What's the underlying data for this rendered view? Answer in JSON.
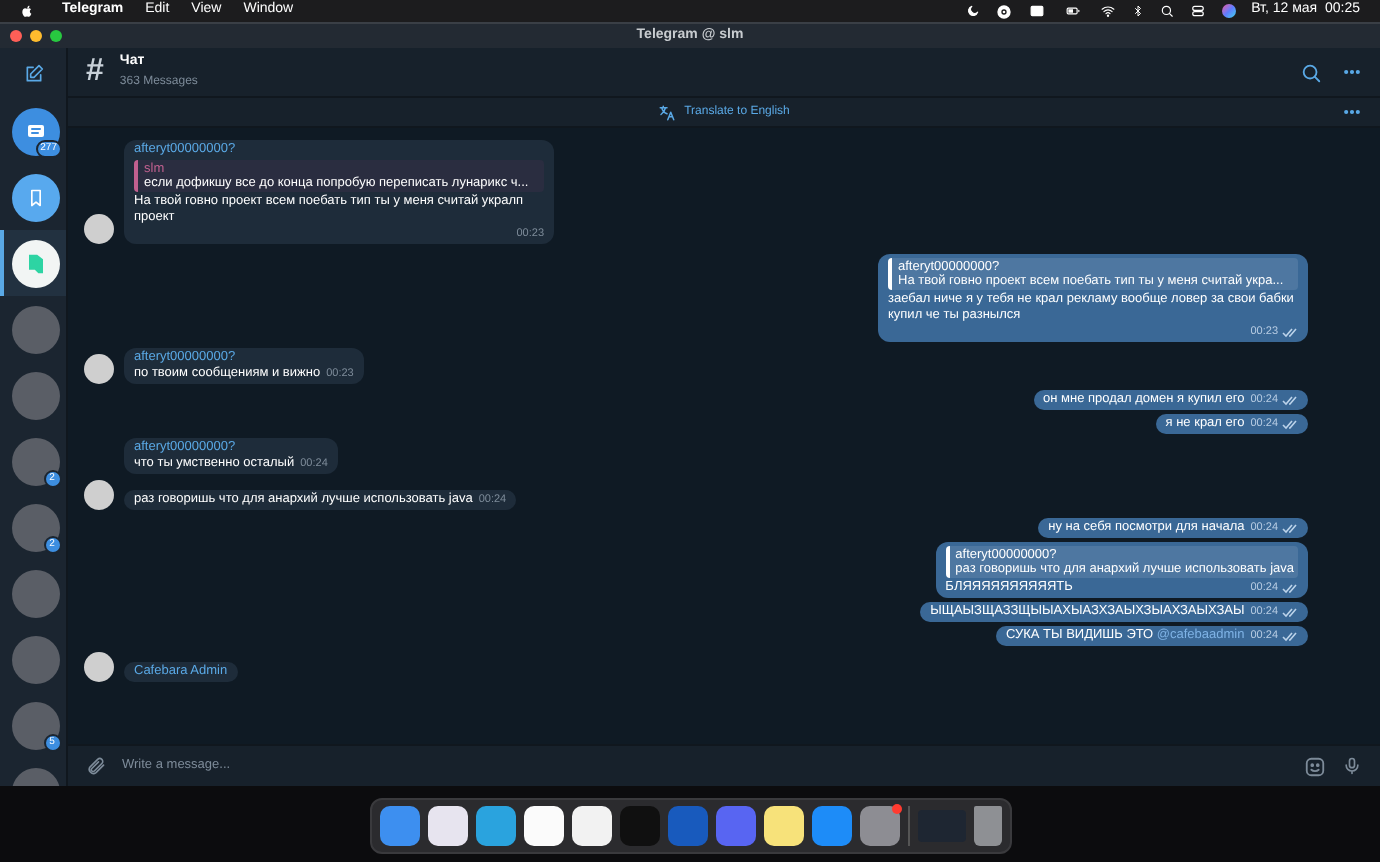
{
  "menu_bar": {
    "app": "Telegram",
    "menus": [
      "Edit",
      "View",
      "Window"
    ],
    "clock": "Вт, 12 мая  00:25"
  },
  "window": {
    "title": "Telegram @ slm"
  },
  "sidebar": {
    "chats": [
      {
        "kind": "chat",
        "selected": false,
        "badge": "277"
      },
      {
        "kind": "saved",
        "selected": false
      },
      {
        "kind": "logo",
        "selected": true
      },
      {
        "kind": "photo",
        "selected": false
      },
      {
        "kind": "photo",
        "selected": false
      },
      {
        "kind": "photo",
        "selected": false,
        "badge": "2"
      },
      {
        "kind": "photo",
        "selected": false,
        "badge": "2"
      },
      {
        "kind": "photo",
        "selected": false
      },
      {
        "kind": "photo",
        "selected": false
      },
      {
        "kind": "photo",
        "selected": false,
        "badge": "5"
      },
      {
        "kind": "photo",
        "selected": false
      }
    ]
  },
  "chat": {
    "icon": "#",
    "title": "Чат",
    "subtitle": "363 Messages",
    "translate": "Translate to English"
  },
  "messages": [
    {
      "kind": "incoming",
      "sender": "afteryt00000000?",
      "reply": {
        "author": "slm",
        "text": "если дофикшу все до конца попробую переписать лунарикс ч..."
      },
      "text": "На твой говно проект всем поебать тип ты у меня считай укралп проект",
      "time": "00:23",
      "avatar": true
    },
    {
      "kind": "outgoing",
      "reply": {
        "author": "afteryt00000000?",
        "text": "На твой говно проект всем поебать тип ты у меня считай укра..."
      },
      "text": "заебал ниче я у тебя не крал рекламу вообще ловер за свои бабки купил че ты разнылся",
      "time": "00:23",
      "read": true
    },
    {
      "kind": "incoming",
      "sender": "afteryt00000000?",
      "text": "по твоим сообщениям и вижно",
      "time": "00:23",
      "avatar": true
    },
    {
      "kind": "outgoing",
      "text": "он мне продал домен я купил его",
      "time": "00:24",
      "read": true
    },
    {
      "kind": "outgoing",
      "text": "я не крал его",
      "time": "00:24",
      "read": true
    },
    {
      "kind": "incoming",
      "sender": "afteryt00000000?",
      "text": "что ты умственно осталый",
      "time": "00:24",
      "avatar": false
    },
    {
      "kind": "incoming",
      "text": "раз говоришь что для анархий лучше использовать java",
      "time": "00:24",
      "avatar": true
    },
    {
      "kind": "outgoing",
      "text": "ну на себя посмотри для начала",
      "time": "00:24",
      "read": true
    },
    {
      "kind": "outgoing",
      "reply": {
        "author": "afteryt00000000?",
        "text": "раз говоришь что для анархий лучше использовать java"
      },
      "text": "БЛЯЯЯЯЯЯЯЯЯЯТЬ",
      "time": "00:24",
      "read": true
    },
    {
      "kind": "outgoing",
      "text": "ЫЩАЫЗЩАЗЗЩЫЫАХЫАЗХЗАЫХЗЫАХЗАЫХЗАЫ",
      "time": "00:24",
      "read": true
    },
    {
      "kind": "outgoing",
      "text": "СУКА ТЫ ВИДИШЬ ЭТО",
      "mention": "@cafebaadmin",
      "time": "00:24",
      "read": true
    },
    {
      "kind": "incoming",
      "sender": "Cafebara Admin",
      "avatar": true
    }
  ],
  "composer": {
    "placeholder": "Write a message..."
  }
}
